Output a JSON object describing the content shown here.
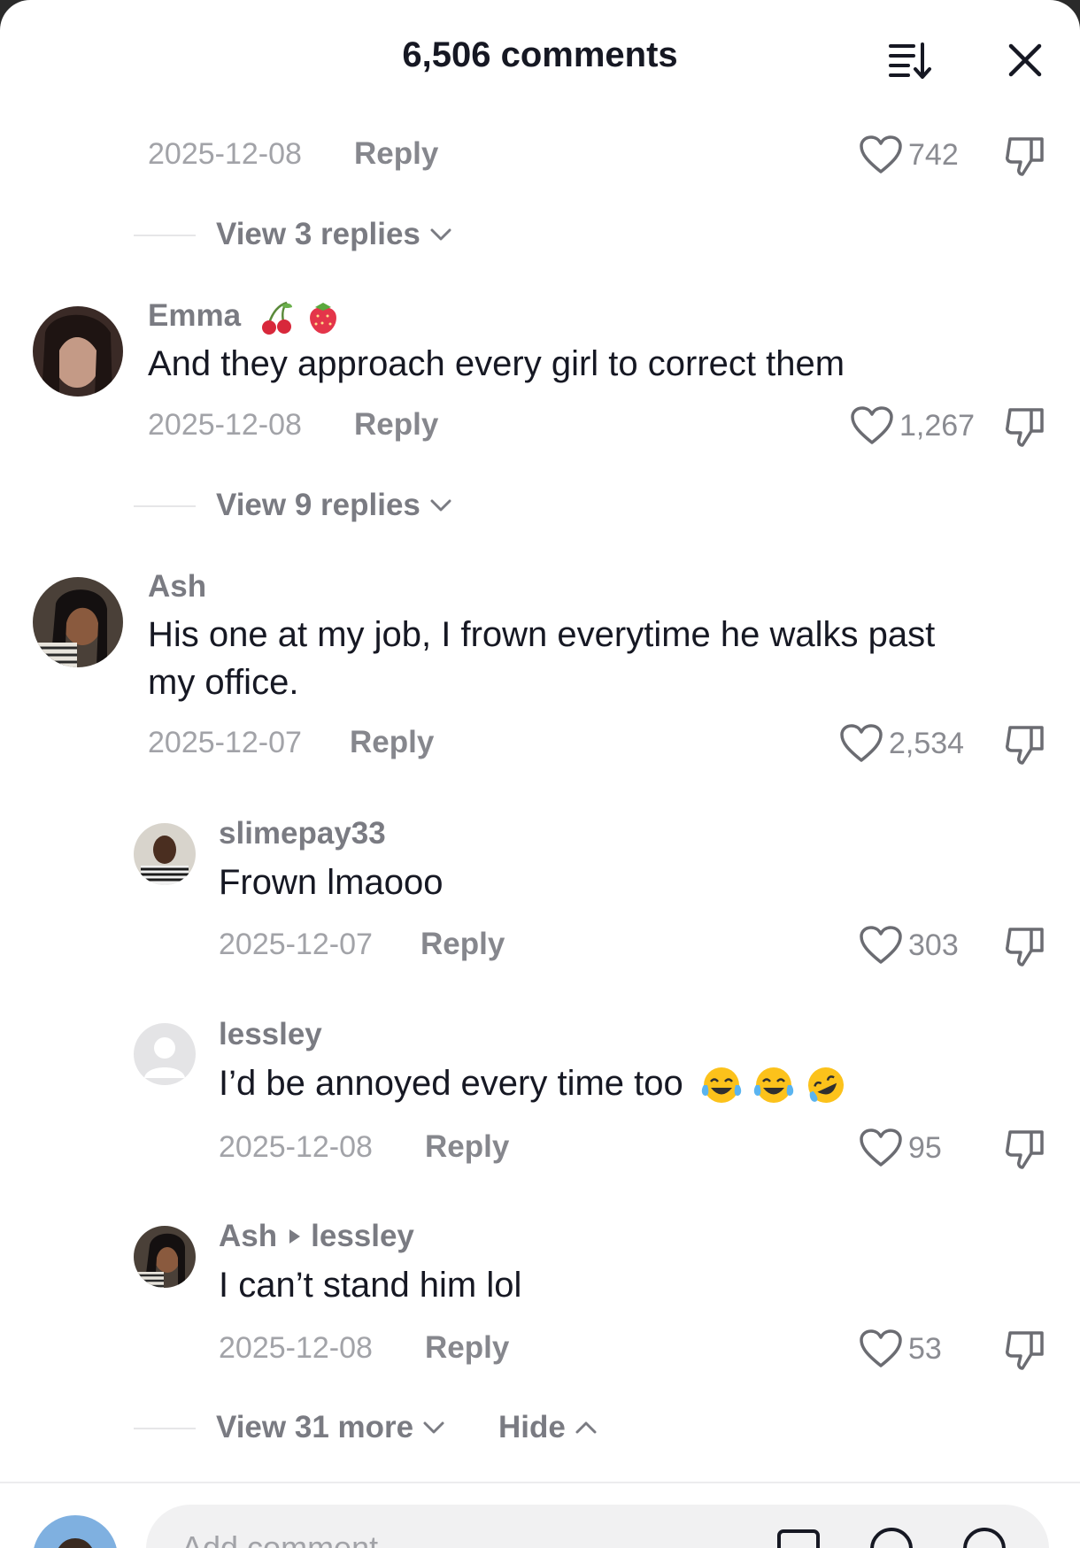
{
  "header": {
    "title": "6,506 comments"
  },
  "top_actions": {
    "date": "2025-12-08",
    "reply_label": "Reply",
    "likes": "742",
    "view_replies": "View 3 replies"
  },
  "comments": [
    {
      "username": "Emma",
      "text": "And they approach every girl to correct them",
      "date": "2025-12-08",
      "reply_label": "Reply",
      "likes": "1,267",
      "view_replies": "View 9 replies"
    },
    {
      "username": "Ash",
      "text_line1": "His one at my job, I frown everytime he walks past",
      "text_line2": "my office.",
      "date": "2025-12-07",
      "reply_label": "Reply",
      "likes": "2,534"
    }
  ],
  "replies": [
    {
      "username": "slimepay33",
      "text": "Frown lmaooo",
      "date": "2025-12-07",
      "reply_label": "Reply",
      "likes": "303"
    },
    {
      "username": "lessley",
      "text": "I’d be annoyed every time too",
      "date": "2025-12-08",
      "reply_label": "Reply",
      "likes": "95"
    },
    {
      "username": "Ash",
      "reply_to": "lessley",
      "text": "I can’t stand him lol",
      "date": "2025-12-08",
      "reply_label": "Reply",
      "likes": "53"
    }
  ],
  "thread_footer": {
    "view_more": "View 31 more",
    "hide": "Hide"
  },
  "composer": {
    "placeholder": "Add comment..."
  },
  "colors": {
    "text_primary": "#161823",
    "text_secondary": "#7a7b82",
    "text_muted": "#a2a3a8",
    "background": "#ffffff"
  },
  "icons": {
    "sort": "sort-icon",
    "close": "close-icon",
    "like": "heart-icon",
    "dislike": "thumbs-down-icon",
    "expand": "chevron-down-icon",
    "collapse": "chevron-up-icon"
  }
}
